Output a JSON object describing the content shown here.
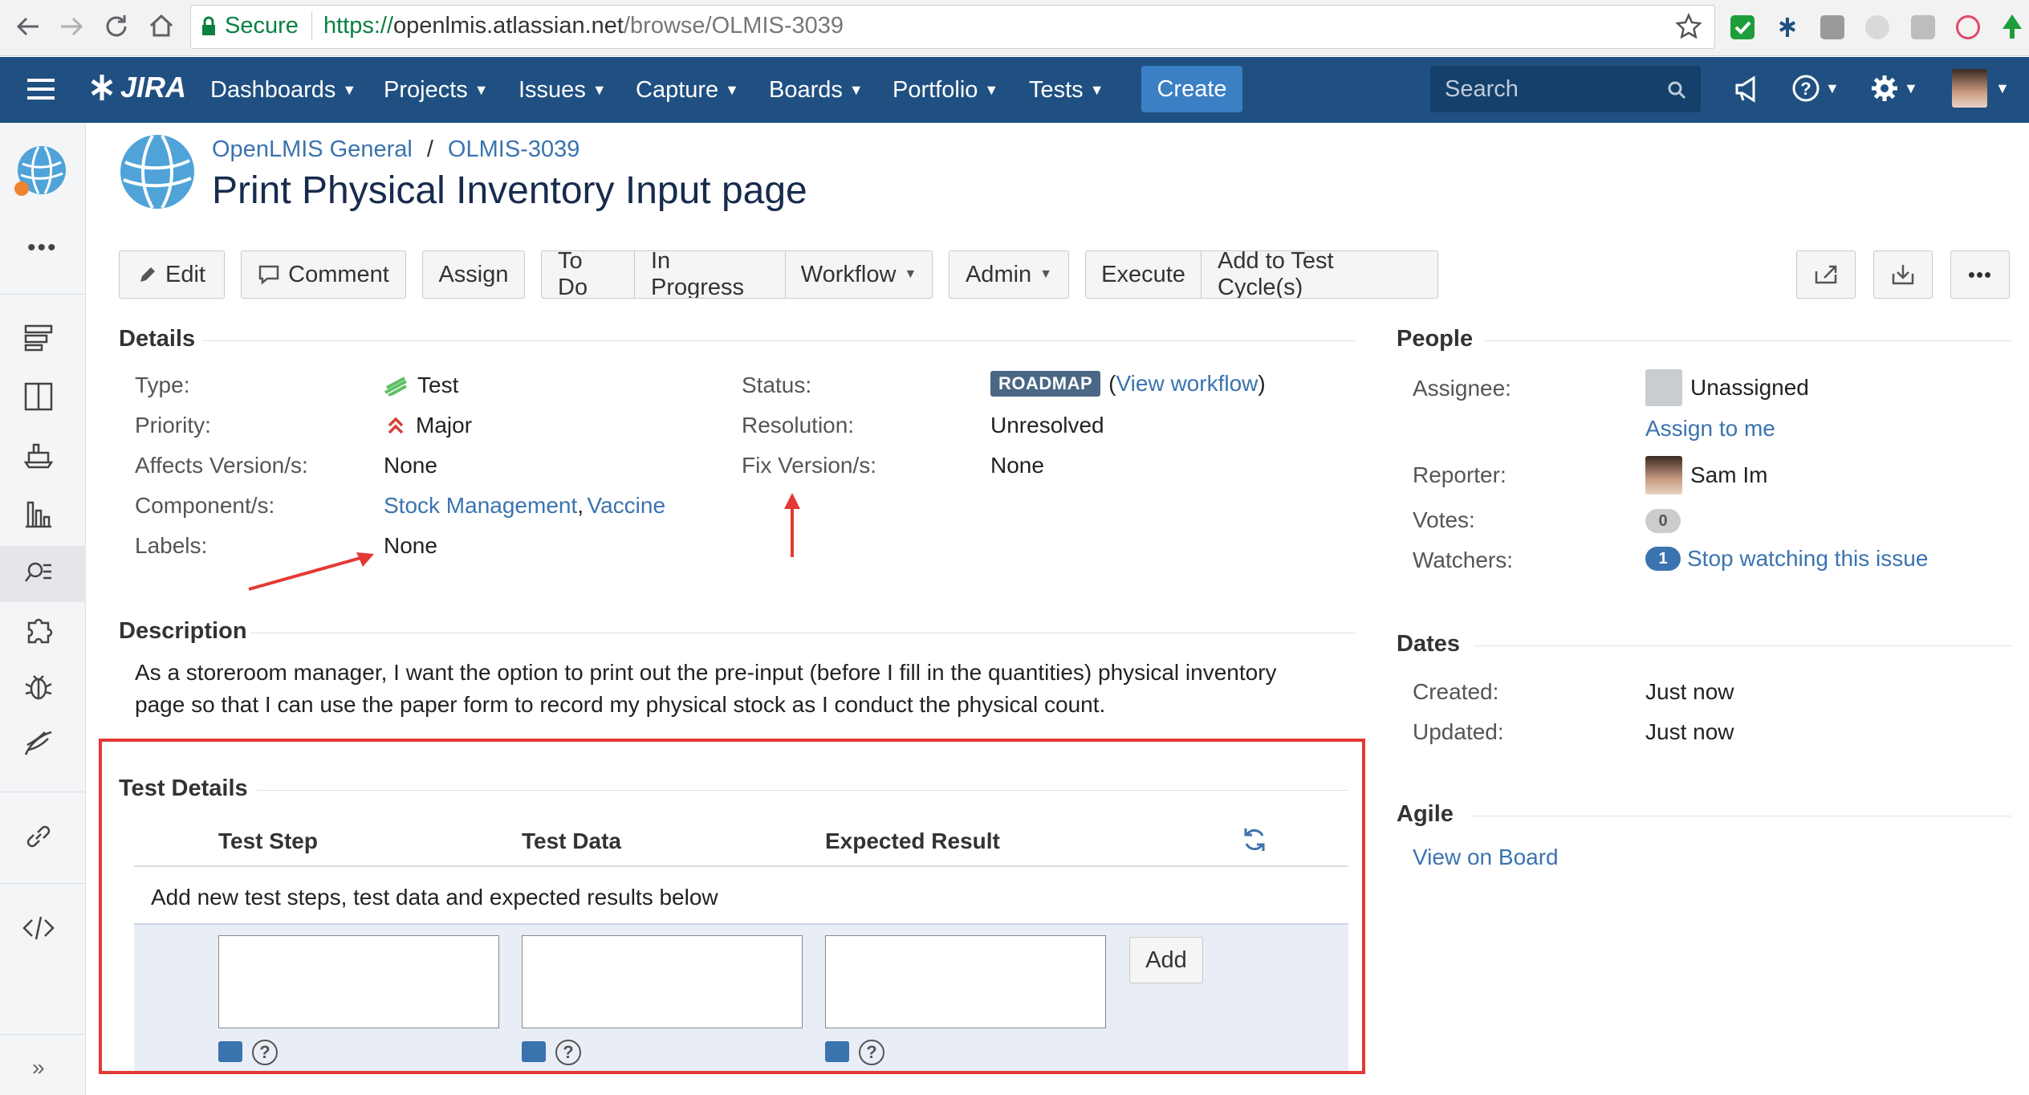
{
  "browser": {
    "secure_label": "Secure",
    "url_scheme": "https://",
    "url_host": "openlmis.atlassian.net",
    "url_path": "/browse/OLMIS-3039"
  },
  "nav": {
    "logo": "JIRA",
    "items": [
      "Dashboards",
      "Projects",
      "Issues",
      "Capture",
      "Boards",
      "Portfolio",
      "Tests"
    ],
    "create_label": "Create",
    "search_placeholder": "Search"
  },
  "breadcrumb": {
    "project": "OpenLMIS General",
    "separator": "/",
    "issue_key": "OLMIS-3039"
  },
  "issue_title": "Print Physical Inventory Input page",
  "toolbar": {
    "edit": "Edit",
    "comment": "Comment",
    "assign": "Assign",
    "todo": "To Do",
    "in_progress": "In Progress",
    "workflow": "Workflow",
    "admin": "Admin",
    "execute": "Execute",
    "add_to_cycle": "Add to Test Cycle(s)"
  },
  "details": {
    "heading": "Details",
    "type_label": "Type:",
    "type_value": "Test",
    "priority_label": "Priority:",
    "priority_value": "Major",
    "affects_label": "Affects Version/s:",
    "affects_value": "None",
    "component_label": "Component/s:",
    "component_1": "Stock Management",
    "component_sep": ",",
    "component_2": "Vaccine",
    "labels_label": "Labels:",
    "labels_value": "None",
    "status_label": "Status:",
    "status_value": "ROADMAP",
    "view_workflow_open": "(",
    "view_workflow": "View workflow",
    "view_workflow_close": ")",
    "resolution_label": "Resolution:",
    "resolution_value": "Unresolved",
    "fix_label": "Fix Version/s:",
    "fix_value": "None"
  },
  "description": {
    "heading": "Description",
    "line1": "As a storeroom manager, I want the option to print out the pre-input (before I fill in the quantities) physical inventory",
    "line2": "page so that I can use the paper form to record my physical stock as I conduct the physical count."
  },
  "test_details": {
    "heading": "Test Details",
    "columns": [
      "Test Step",
      "Test Data",
      "Expected Result"
    ],
    "hint": "Add new test steps, test data and expected results below",
    "add_label": "Add",
    "help_glyph": "?"
  },
  "people": {
    "heading": "People",
    "assignee_label": "Assignee:",
    "assignee_value": "Unassigned",
    "assign_to_me": "Assign to me",
    "reporter_label": "Reporter:",
    "reporter_value": "Sam Im",
    "votes_label": "Votes:",
    "votes_count": "0",
    "watchers_label": "Watchers:",
    "watchers_count": "1",
    "watch_link": "Stop watching this issue"
  },
  "dates": {
    "heading": "Dates",
    "created_label": "Created:",
    "created_value": "Just now",
    "updated_label": "Updated:",
    "updated_value": "Just now"
  },
  "agile": {
    "heading": "Agile",
    "view_on_board": "View on Board"
  },
  "colors": {
    "header": "#205081",
    "link": "#3b73af",
    "annotation": "#e53935"
  }
}
